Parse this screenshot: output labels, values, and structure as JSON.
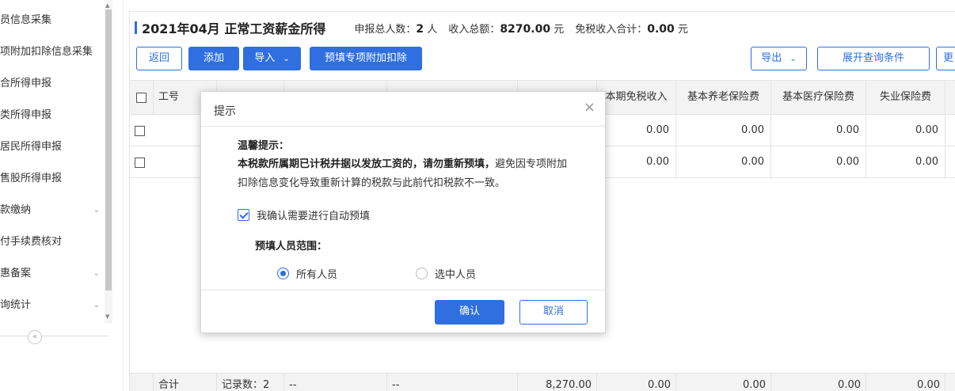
{
  "sidebar": {
    "items": [
      {
        "label": "员信息采集",
        "chevron": ""
      },
      {
        "label": "项附加扣除信息采集",
        "chevron": ""
      },
      {
        "label": "合所得申报",
        "chevron": ""
      },
      {
        "label": "类所得申报",
        "chevron": ""
      },
      {
        "label": "居民所得申报",
        "chevron": ""
      },
      {
        "label": "售股所得申报",
        "chevron": ""
      },
      {
        "label": "款缴纳",
        "chevron": "⌄"
      },
      {
        "label": "付手续费核对",
        "chevron": ""
      },
      {
        "label": "惠备案",
        "chevron": "⌄"
      },
      {
        "label": "询统计",
        "chevron": "⌄"
      }
    ],
    "collapse_glyph": "«"
  },
  "header": {
    "title": "2021年04月 正常工资薪金所得",
    "total_people_label": "申报总人数：",
    "total_people_value": "2",
    "total_people_unit": "人",
    "total_income_label": "收入总额：",
    "total_income_value": "8270.00",
    "total_income_unit": "元",
    "tax_free_label": "免税收入合计：",
    "tax_free_value": "0.00",
    "tax_free_unit": "元"
  },
  "toolbar": {
    "back_label": "返回",
    "add_label": "添加",
    "import_label": "导入",
    "prefill_label": "预填专项附加扣除",
    "export_label": "导出",
    "expand_query_label": "展开查询条件",
    "more_label": "更"
  },
  "table": {
    "columns": [
      "工号",
      "本期免税收入",
      "基本养老保险费",
      "基本医疗保险费",
      "失业保险费"
    ],
    "rows": [
      {
        "tax_free": "0.00",
        "pension": "0.00",
        "medical": "0.00",
        "unemployment": "0.00"
      },
      {
        "tax_free": "0.00",
        "pension": "0.00",
        "medical": "0.00",
        "unemployment": "0.00"
      }
    ],
    "footer": {
      "total_label": "合计",
      "record_count": "记录数：2",
      "dash1": "--",
      "dash2": "--",
      "income": "8,270.00",
      "tax_free": "0.00",
      "pension": "0.00",
      "medical": "0.00",
      "unemployment": "0.00"
    }
  },
  "modal": {
    "title": "提示",
    "close_glyph": "×",
    "warn_title": "温馨提示：",
    "warn_bold": "本税款所属期已计税并据以发放工资的，请勿重新预填，",
    "warn_rest": "避免因专项附加扣除信息变化导致重新计算的税款与此前代扣税款不一致。",
    "confirm_auto_label": "我确认需要进行自动预填",
    "confirm_auto_checked": true,
    "range_label": "预填人员范围：",
    "range_options": [
      {
        "label": "所有人员",
        "selected": true
      },
      {
        "label": "选中人员",
        "selected": false
      }
    ],
    "confirm_button": "确认",
    "cancel_button": "取消"
  },
  "colors": {
    "accent": "#2f6fe0"
  }
}
